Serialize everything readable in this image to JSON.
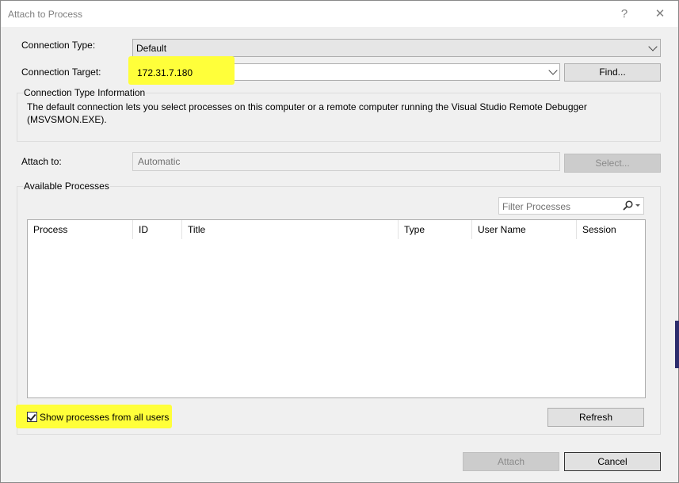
{
  "window": {
    "title": "Attach to Process",
    "help_glyph": "?",
    "close_glyph": "✕"
  },
  "connection": {
    "type_label": "Connection Type:",
    "type_value": "Default",
    "target_label": "Connection Target:",
    "target_value": "172.31.7.180",
    "find_label": "Find..."
  },
  "info": {
    "group_title": "Connection Type Information",
    "text": "The default connection lets you select processes on this computer or a remote computer running the Visual Studio Remote Debugger (MSVSMON.EXE)."
  },
  "attach_to": {
    "label": "Attach to:",
    "value": "Automatic",
    "select_label": "Select..."
  },
  "processes": {
    "group_title": "Available Processes",
    "filter_placeholder": "Filter Processes",
    "columns": [
      "Process",
      "ID",
      "Title",
      "Type",
      "User Name",
      "Session"
    ],
    "show_all_users_label": "Show processes from all users",
    "show_all_users_checked": true,
    "refresh_label": "Refresh"
  },
  "footer": {
    "attach_label": "Attach",
    "cancel_label": "Cancel"
  },
  "colors": {
    "highlight": "#ffff3a",
    "dialog_bg": "#f0f0f0"
  },
  "icons": [
    "chevron-down-icon",
    "search-icon",
    "checkmark-icon",
    "help-icon",
    "close-icon"
  ]
}
